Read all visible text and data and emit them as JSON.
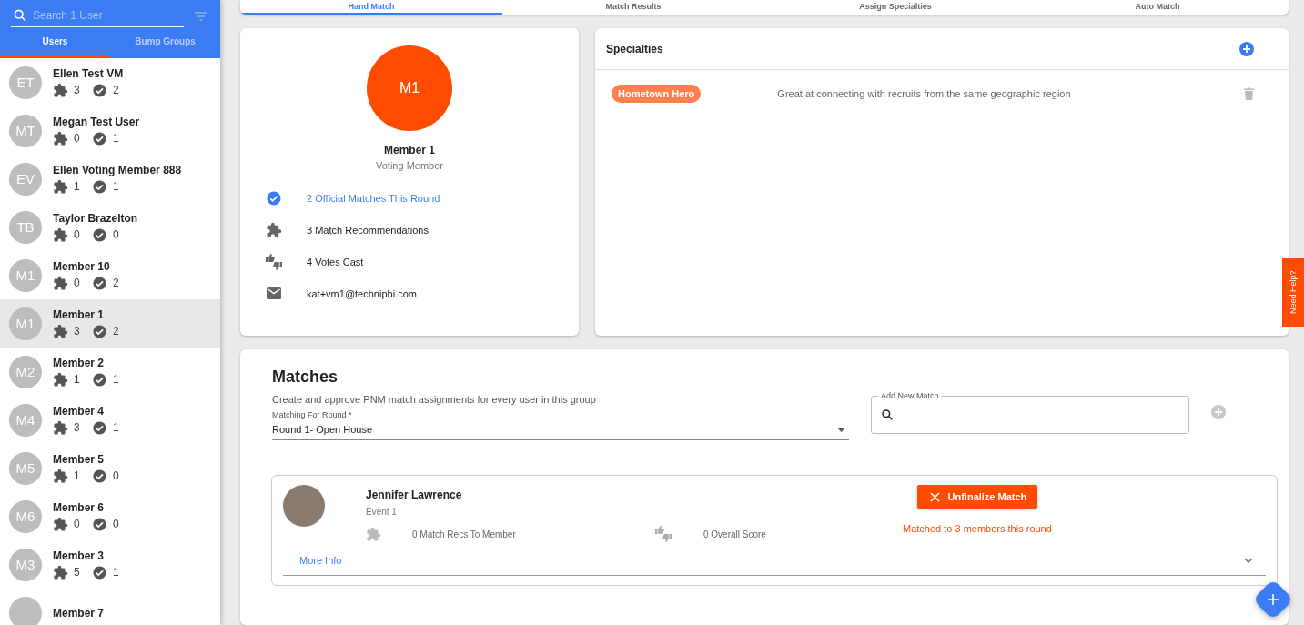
{
  "sidebar": {
    "search": {
      "placeholder": "Search 1 User"
    },
    "tabs": [
      {
        "label": "Users",
        "selected": true
      },
      {
        "label": "Bump Groups",
        "selected": false
      }
    ],
    "users": [
      {
        "initials": "ET",
        "name": "Ellen Test VM",
        "recommendations": "3",
        "matches": "2",
        "selected": false
      },
      {
        "initials": "MT",
        "name": "Megan Test User",
        "recommendations": "0",
        "matches": "1",
        "selected": false
      },
      {
        "initials": "EV",
        "name": "Ellen Voting Member 888",
        "recommendations": "1",
        "matches": "1",
        "selected": false
      },
      {
        "initials": "TB",
        "name": "Taylor Brazelton",
        "recommendations": "0",
        "matches": "0",
        "selected": false
      },
      {
        "initials": "M1",
        "name": "Member 10",
        "recommendations": "0",
        "matches": "2",
        "selected": false
      },
      {
        "initials": "M1",
        "name": "Member 1",
        "recommendations": "3",
        "matches": "2",
        "selected": true
      },
      {
        "initials": "M2",
        "name": "Member 2",
        "recommendations": "1",
        "matches": "1",
        "selected": false
      },
      {
        "initials": "M4",
        "name": "Member 4",
        "recommendations": "3",
        "matches": "1",
        "selected": false
      },
      {
        "initials": "M5",
        "name": "Member 5",
        "recommendations": "1",
        "matches": "0",
        "selected": false
      },
      {
        "initials": "M6",
        "name": "Member 6",
        "recommendations": "0",
        "matches": "0",
        "selected": false
      },
      {
        "initials": "M3",
        "name": "Member 3",
        "recommendations": "5",
        "matches": "1",
        "selected": false
      },
      {
        "name": "Member 7",
        "selected": false
      }
    ]
  },
  "top_tabs": [
    {
      "label": "Hand Match",
      "selected": true
    },
    {
      "label": "Match Results",
      "selected": false
    },
    {
      "label": "Assign Specialties",
      "selected": false
    },
    {
      "label": "Auto Match",
      "selected": false
    }
  ],
  "profile": {
    "initials": "M1",
    "name": "Member 1",
    "role": "Voting Member",
    "stats": [
      {
        "kind": "matches",
        "text": "2 Official Matches This Round"
      },
      {
        "kind": "recommendations",
        "text": "3 Match Recommendations"
      },
      {
        "kind": "votes",
        "text": "4 Votes Cast"
      },
      {
        "kind": "email",
        "text": "kat+vm1@techniphi.com"
      }
    ]
  },
  "specialties": {
    "title": "Specialties",
    "items": [
      {
        "tag": "Hometown Hero",
        "description": "Great at connecting with recruits from the same geographic region"
      }
    ]
  },
  "matches": {
    "title": "Matches",
    "subtitle": "Create and approve PNM match assignments for every user in this group",
    "round_field": {
      "label": "Matching For Round *",
      "value": "Round 1- Open House"
    },
    "add_field": {
      "label": "Add New Match"
    },
    "cards": [
      {
        "name": "Jennifer Lawrence",
        "event": "Event 1",
        "recs": "0 Match Recs To Member",
        "score": "0 Overall Score",
        "button": "Unfinalize Match",
        "status": "Matched to 3 members this round",
        "link": "More Info"
      }
    ]
  },
  "help_tab": "Need Help?"
}
